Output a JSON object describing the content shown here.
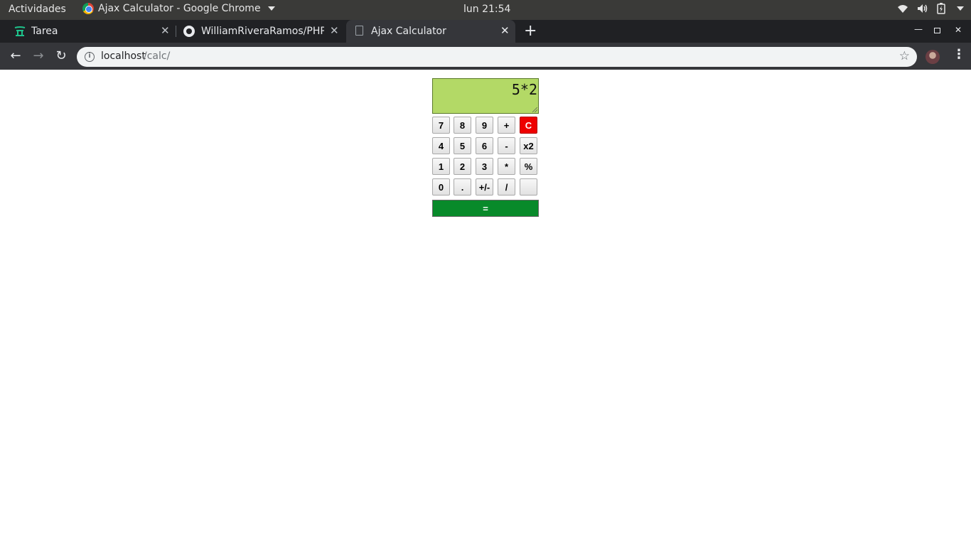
{
  "system_bar": {
    "activities": "Actividades",
    "app_title": "Ajax Calculator - Google Chrome",
    "clock": "lun 21:54"
  },
  "tabs": [
    {
      "title": "Tarea",
      "icon": "tarea-favicon-icon",
      "active": false
    },
    {
      "title": "WilliamRiveraRamos/PHP",
      "icon": "github-icon",
      "active": false
    },
    {
      "title": "Ajax Calculator",
      "icon": "document-icon",
      "active": true
    }
  ],
  "address_bar": {
    "host": "localhost",
    "path": "/calc/"
  },
  "calculator": {
    "display": "5*2",
    "rows": [
      [
        "7",
        "8",
        "9",
        "+",
        "C"
      ],
      [
        "4",
        "5",
        "6",
        "-",
        "x2"
      ],
      [
        "1",
        "2",
        "3",
        "*",
        "%"
      ],
      [
        "0",
        ".",
        "+/-",
        "/",
        ""
      ]
    ],
    "equals": "=",
    "colors": {
      "display_bg": "#b3d966",
      "clear_bg": "#ee0000",
      "equals_bg": "#088a2a"
    }
  }
}
